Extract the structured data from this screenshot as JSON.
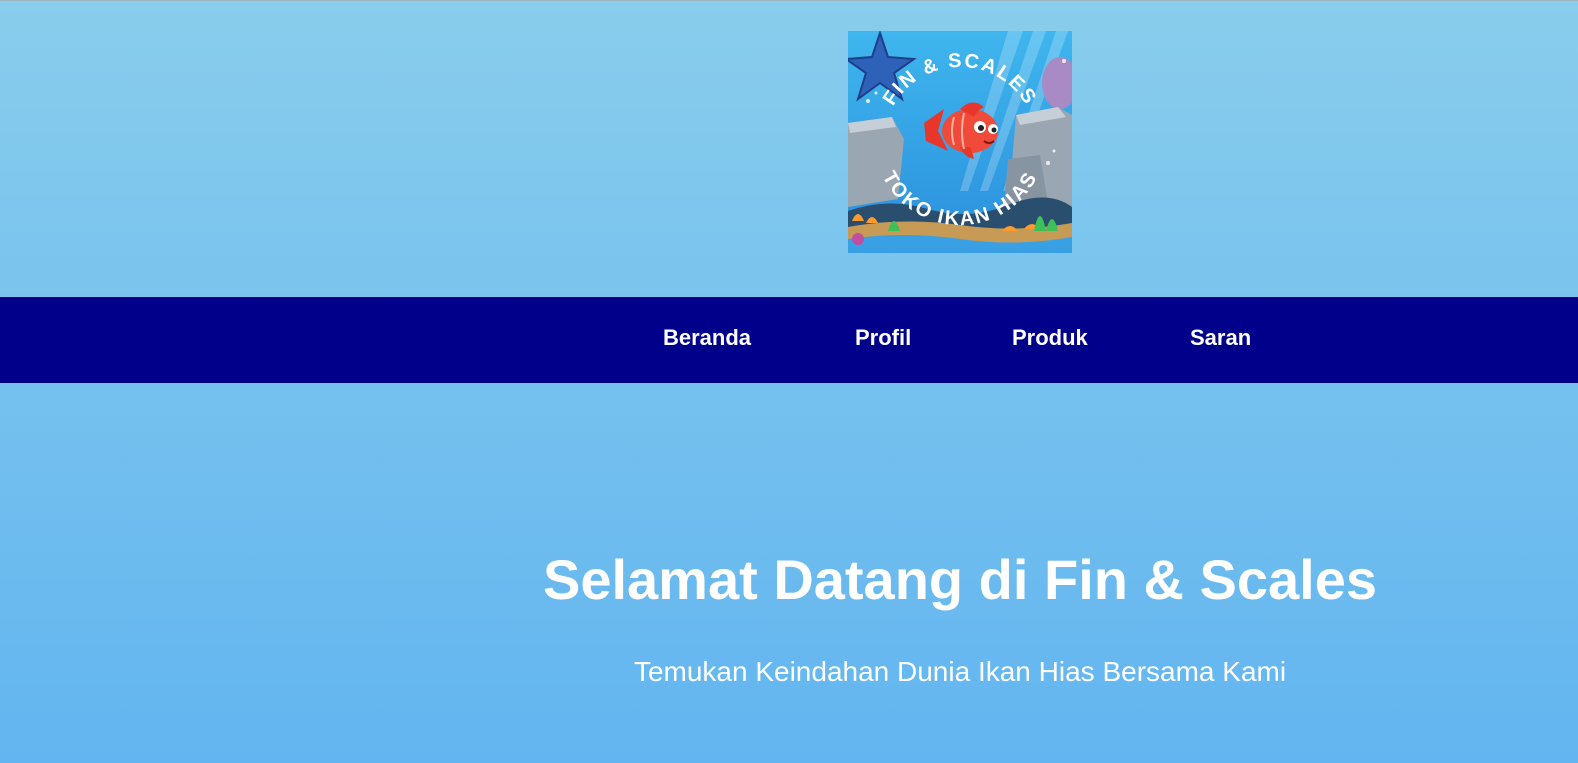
{
  "logo": {
    "icon": "fish-shop-logo",
    "arc_text_top": "FIN & SCALES",
    "arc_text_bottom": "TOKO IKAN HIAS"
  },
  "nav": {
    "items": [
      {
        "label": "Beranda"
      },
      {
        "label": "Profil"
      },
      {
        "label": "Produk"
      },
      {
        "label": "Saran"
      }
    ]
  },
  "hero": {
    "title": "Selamat Datang di Fin & Scales",
    "subtitle": "Temukan Keindahan Dunia Ikan Hias Bersama Kami"
  },
  "colors": {
    "nav_background": "#00008b",
    "page_gradient_top": "#89cdec",
    "page_gradient_bottom": "#62b5f0",
    "text": "#ffffff"
  }
}
